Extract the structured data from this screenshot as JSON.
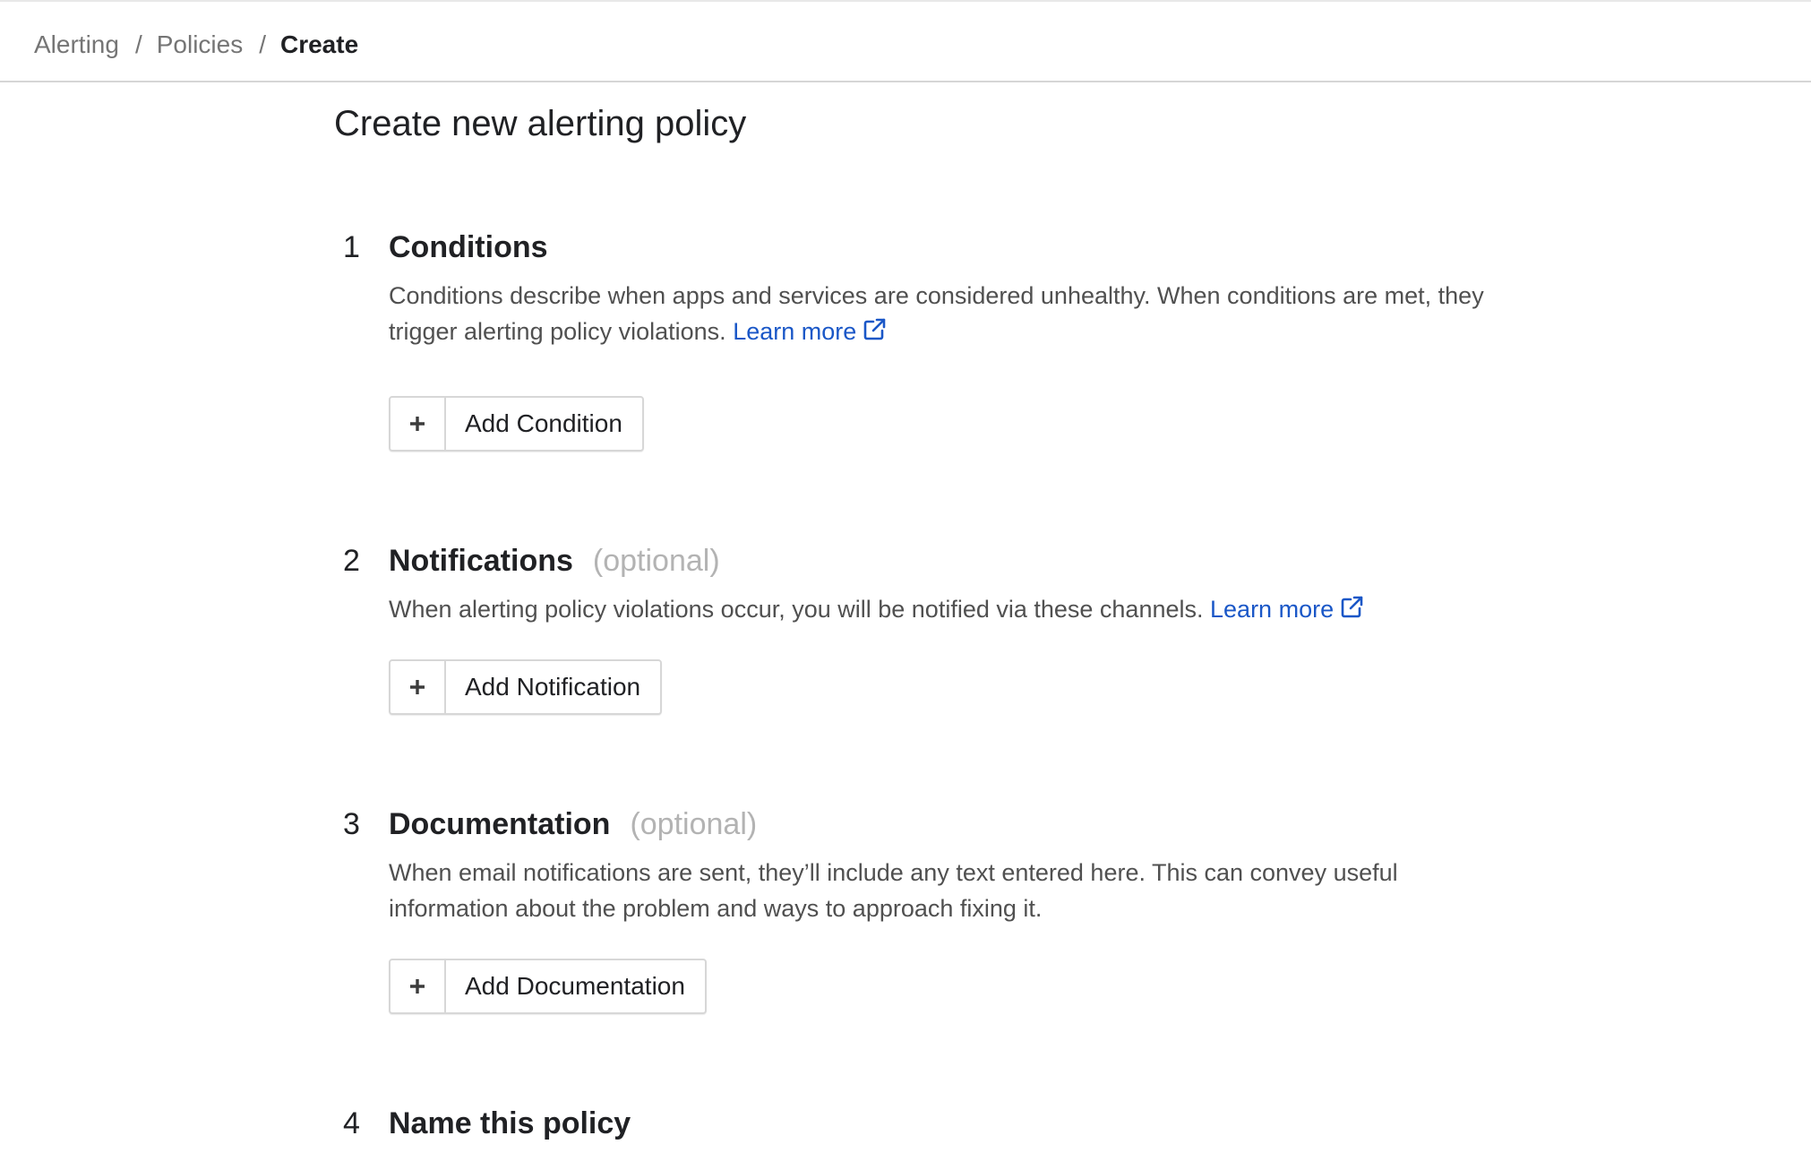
{
  "breadcrumb": {
    "items": [
      "Alerting",
      "Policies"
    ],
    "current": "Create",
    "separator": "/"
  },
  "page": {
    "title": "Create new alerting policy"
  },
  "steps": [
    {
      "number": "1",
      "title": "Conditions",
      "optional": "",
      "description": "Conditions describe when apps and services are considered unhealthy. When conditions are met, they trigger alerting policy violations.",
      "learn_more": "Learn more",
      "button_label": "Add Condition"
    },
    {
      "number": "2",
      "title": "Notifications",
      "optional": "(optional)",
      "description": "When alerting policy violations occur, you will be notified via these channels.",
      "learn_more": "Learn more",
      "button_label": "Add Notification"
    },
    {
      "number": "3",
      "title": "Documentation",
      "optional": "(optional)",
      "description": "When email notifications are sent, they’ll include any text entered here. This can convey useful information about the problem and ways to approach fixing it.",
      "learn_more": "",
      "button_label": "Add Documentation"
    },
    {
      "number": "4",
      "title": "Name this policy",
      "optional": "",
      "description": "",
      "learn_more": "",
      "button_label": ""
    }
  ],
  "icons": {
    "add": "plus-icon",
    "external_link": "external-link-icon"
  },
  "colors": {
    "link": "#1a57c7",
    "optional_text": "#b3b3b3",
    "muted_text": "#757575",
    "body_text": "#505050"
  }
}
